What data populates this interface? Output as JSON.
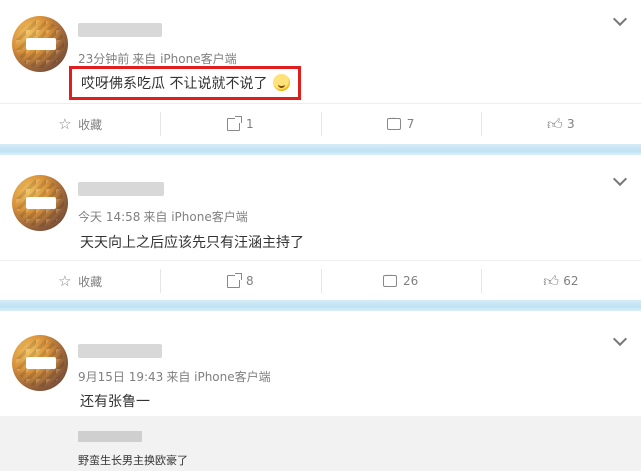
{
  "posts": [
    {
      "meta_time": "23分钟前",
      "meta_source": "来自 iPhone客户端",
      "content": "哎呀佛系吃瓜 不让说就不说了",
      "emoji": "laughing-face",
      "actions": {
        "favorite": "收藏",
        "forward": "1",
        "comment": "7",
        "like": "3"
      }
    },
    {
      "meta_time": "今天 14:58",
      "meta_source": "来自 iPhone客户端",
      "content": "天天向上之后应该先只有汪涵主持了",
      "actions": {
        "favorite": "收藏",
        "forward": "8",
        "comment": "26",
        "like": "62"
      }
    },
    {
      "meta_time": "9月15日 19:43",
      "meta_source": "来自 iPhone客户端",
      "content": "还有张鲁一",
      "reply": {
        "text": "野蛮生长男主换欧豪了"
      }
    }
  ],
  "colors": {
    "highlight": "#e01e1e",
    "separator": "#bfe2f3",
    "meta": "#808080"
  }
}
